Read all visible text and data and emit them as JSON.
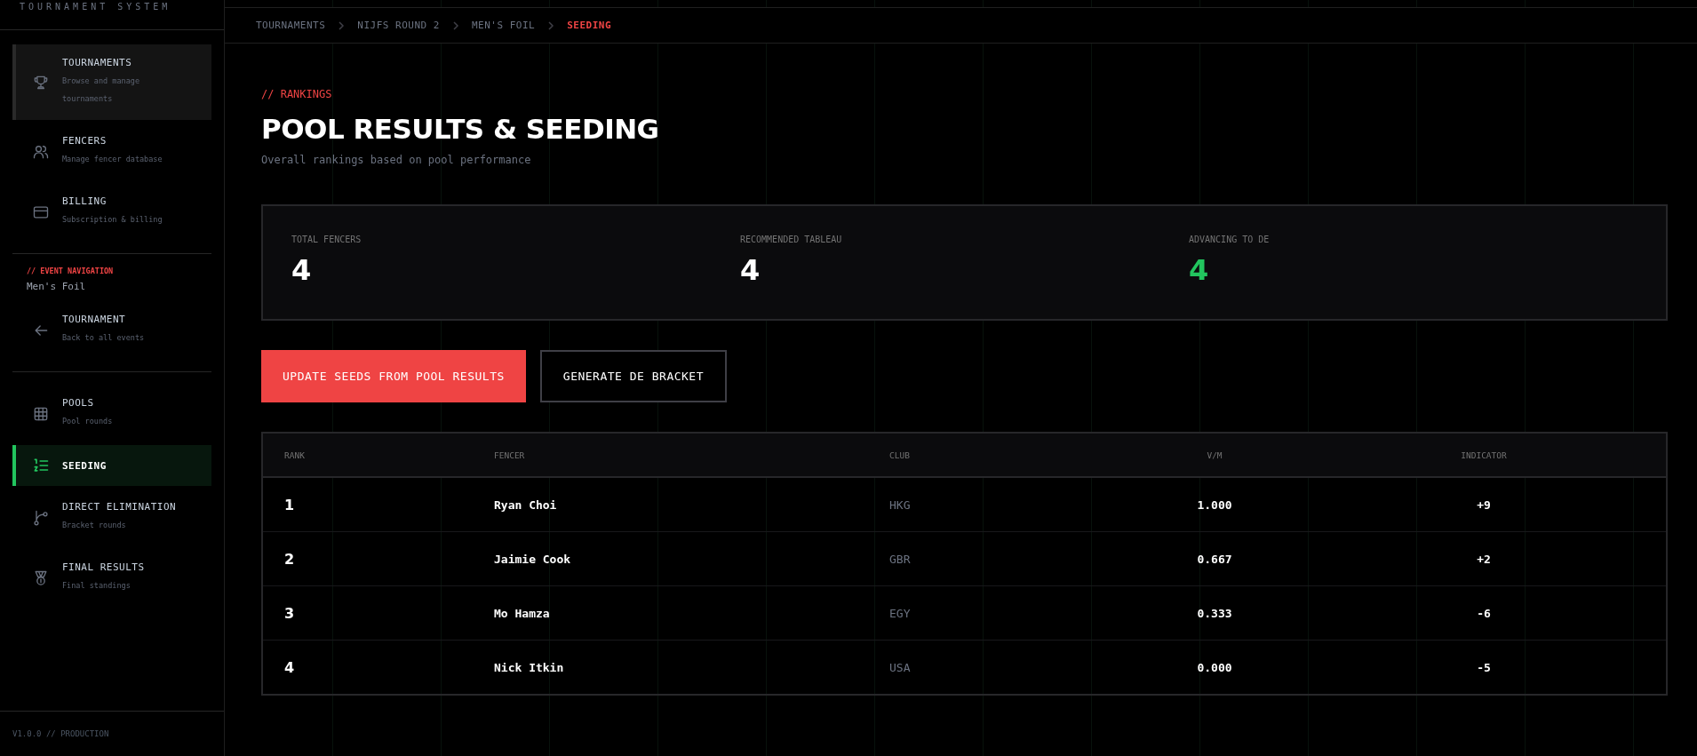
{
  "sidebar": {
    "brand_subtitle": "TOURNAMENT SYSTEM",
    "main_items": [
      {
        "label": "TOURNAMENTS",
        "description": "Browse and manage tournaments",
        "highlighted": true,
        "selected": false
      },
      {
        "label": "FENCERS",
        "description": "Manage fencer database",
        "highlighted": false,
        "selected": false
      },
      {
        "label": "BILLING",
        "description": "Subscription & billing",
        "highlighted": false,
        "selected": false
      }
    ],
    "event_nav_label": "// EVENT NAVIGATION",
    "event_name": "Men's Foil",
    "back_item": {
      "label": "TOURNAMENT",
      "description": "Back to all events"
    },
    "event_items": [
      {
        "label": "POOLS",
        "description": "Pool rounds",
        "highlighted": false,
        "selected": false
      },
      {
        "label": "SEEDING",
        "highlighted": false,
        "selected": true
      },
      {
        "label": "DIRECT ELIMINATION",
        "description": "Bracket rounds",
        "highlighted": false,
        "selected": false
      },
      {
        "label": "FINAL RESULTS",
        "description": "Final standings",
        "highlighted": false,
        "selected": false
      }
    ],
    "version": "V1.0.0 // PRODUCTION"
  },
  "breadcrumb": [
    {
      "label": "TOURNAMENTS",
      "selected": false
    },
    {
      "label": "NIJFS ROUND 2",
      "selected": false
    },
    {
      "label": "MEN'S FOIL",
      "selected": false
    },
    {
      "label": "SEEDING",
      "selected": true
    }
  ],
  "header": {
    "eyebrow": "// RANKINGS",
    "title": "POOL RESULTS & SEEDING",
    "subtitle": "Overall rankings based on pool performance"
  },
  "stats": [
    {
      "label": "TOTAL FENCERS",
      "value": "4",
      "color": "#ffffff"
    },
    {
      "label": "RECOMMENDED TABLEAU",
      "value": "4",
      "color": "#ffffff"
    },
    {
      "label": "ADVANCING TO DE",
      "value": "4",
      "color": "#22c55e"
    }
  ],
  "buttons": [
    {
      "label": "UPDATE SEEDS FROM POOL RESULTS",
      "kind": "primary"
    },
    {
      "label": "GENERATE DE BRACKET",
      "kind": "outline"
    }
  ],
  "table": {
    "columns": [
      "RANK",
      "FENCER",
      "CLUB",
      "V/M",
      "INDICATOR"
    ],
    "rows": [
      {
        "rank": "1",
        "fencer": "Ryan Choi",
        "club": "HKG",
        "vm": "1.000",
        "indicator": "+9"
      },
      {
        "rank": "2",
        "fencer": "Jaimie Cook",
        "club": "GBR",
        "vm": "0.667",
        "indicator": "+2"
      },
      {
        "rank": "3",
        "fencer": "Mo Hamza",
        "club": "EGY",
        "vm": "0.333",
        "indicator": "-6"
      },
      {
        "rank": "4",
        "fencer": "Nick Itkin",
        "club": "USA",
        "vm": "0.000",
        "indicator": "-5"
      }
    ]
  }
}
